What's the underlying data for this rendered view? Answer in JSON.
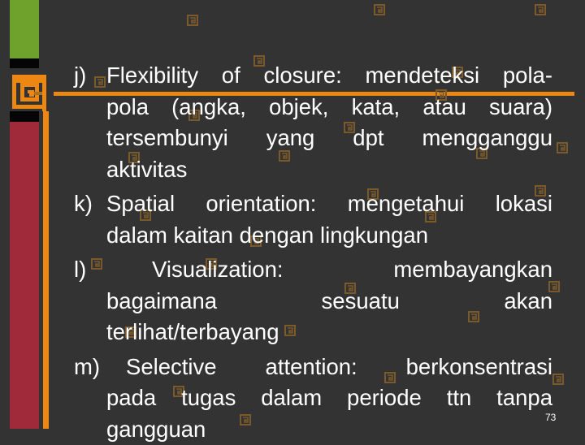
{
  "slide": {
    "page_number": "73",
    "colors": {
      "background": "#333333",
      "green_accent": "#6fa22c",
      "red_accent": "#a0293a",
      "orange_accent": "#ec8714",
      "watermark": "#7a5a2a",
      "text": "#ffffff"
    },
    "items": [
      {
        "label": "j)",
        "lines": [
          "Flexibility of closure: mendeteksi pola-",
          "pola (angka, objek, kata, atau suara)",
          "tersembunyi yang dpt mengganggu",
          "aktivitas"
        ]
      },
      {
        "label": "k)",
        "lines": [
          "Spatial orientation: mengetahui lokasi",
          "dalam kaitan dengan lingkungan"
        ]
      },
      {
        "label": "l)",
        "lines": [
          "Visualization: membayangkan",
          "bagaimana sesuatu akan",
          "terlihat/terbayang"
        ]
      },
      {
        "label": "m)",
        "lines": [
          "Selective attention: berkonsentrasi",
          "pada tugas dalam periode ttn tanpa",
          "gangguan"
        ]
      }
    ]
  }
}
